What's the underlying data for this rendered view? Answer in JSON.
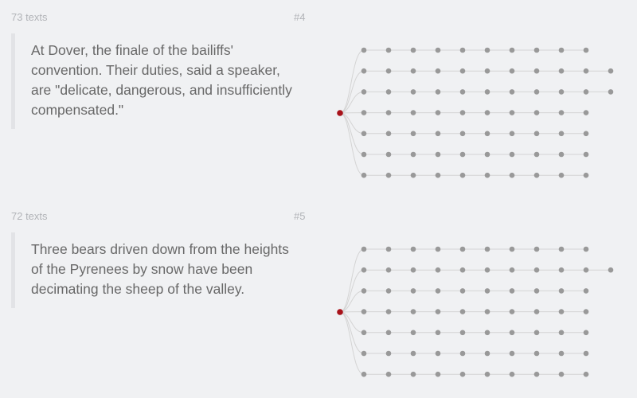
{
  "colors": {
    "background": "#f0f1f3",
    "root": "#a8121a",
    "node": "#999999",
    "edge": "#d4d4d4"
  },
  "cards": [
    {
      "count_label": "73 texts",
      "index_label": "#4",
      "text": "At Dover, the finale of the bailiffs' convention. Their duties, said a speaker, are \"delicate, dangerous, and insufficiently compensated.\"",
      "branches": [
        10,
        11,
        11,
        10,
        10,
        10,
        10
      ]
    },
    {
      "count_label": "72 texts",
      "index_label": "#5",
      "text": "Three bears driven down from the heights of the Pyrenees by snow have been decimating the sheep of the valley.",
      "branches": [
        10,
        11,
        10,
        10,
        10,
        10,
        10
      ]
    }
  ]
}
